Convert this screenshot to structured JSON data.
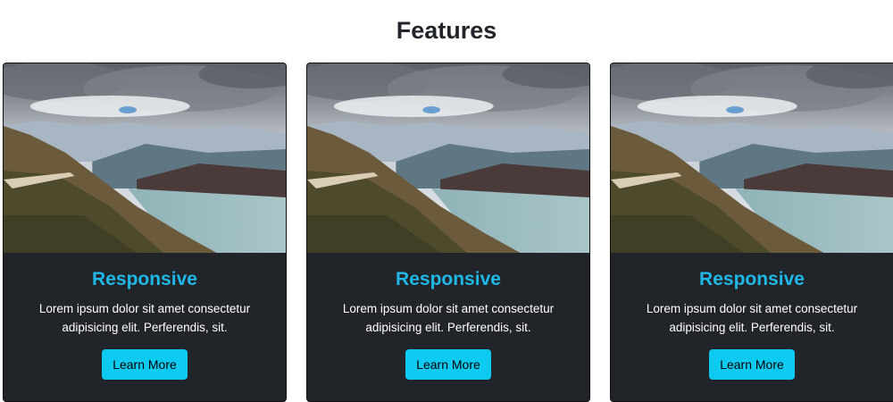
{
  "heading": "Features",
  "cards": [
    {
      "image_icon": "mountain-lake-landscape-photo",
      "title": "Responsive",
      "text": "Lorem ipsum dolor sit amet consectetur adipisicing elit. Perferendis, sit.",
      "button_label": "Learn More"
    },
    {
      "image_icon": "mountain-lake-landscape-photo",
      "title": "Responsive",
      "text": "Lorem ipsum dolor sit amet consectetur adipisicing elit. Perferendis, sit.",
      "button_label": "Learn More"
    },
    {
      "image_icon": "mountain-lake-landscape-photo",
      "title": "Responsive",
      "text": "Lorem ipsum dolor sit amet consectetur adipisicing elit. Perferendis, sit.",
      "button_label": "Learn More"
    }
  ],
  "colors": {
    "card_bg": "#212529",
    "title_accent": "#1fb8e6",
    "button_bg": "#0dcaf0"
  }
}
